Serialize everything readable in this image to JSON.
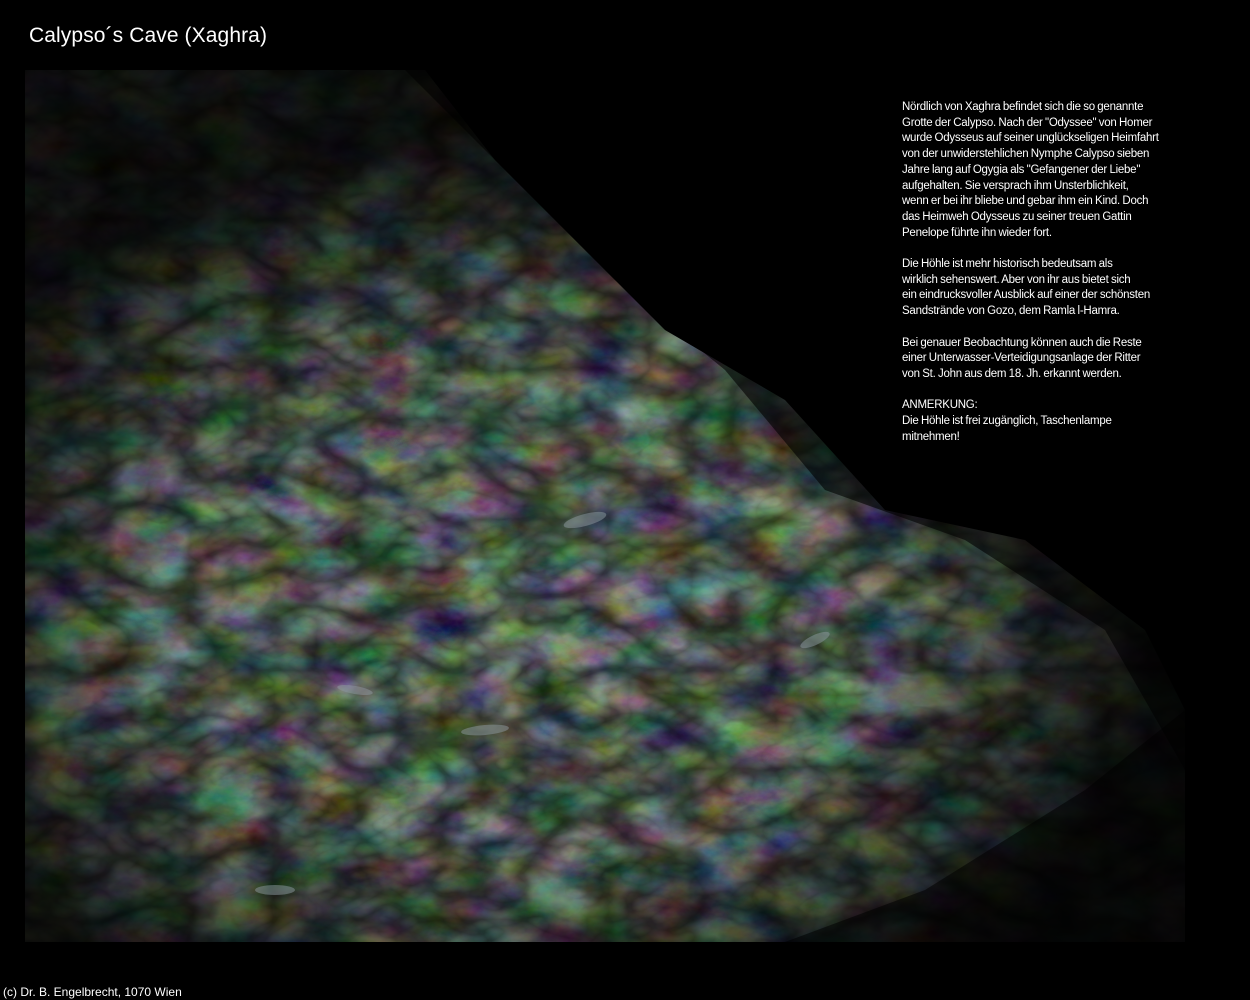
{
  "page": {
    "title": "Calypso´s Cave (Xaghra)",
    "copyright": "(c) Dr. B. Engelbrecht, 1070 Wien"
  },
  "photo": {
    "subject": "rock wall inside cave, dimly lit",
    "colors": {
      "rock_dark": "#1a1f1c",
      "rock_mid": "#3b403a",
      "rock_light": "#6f7266",
      "highlight": "#a9b3b8",
      "background": "#000000"
    }
  },
  "description": {
    "paragraphs": [
      "Nördlich von Xaghra befindet sich die so genannte\nGrotte der Calypso. Nach der \"Odyssee\" von Homer\nwurde Odysseus auf seiner unglückseligen Heimfahrt\nvon der unwiderstehlichen Nymphe Calypso sieben\nJahre lang auf Ogygia als \"Gefangener der Liebe\"\naufgehalten. Sie versprach ihm Unsterblichkeit,\nwenn er bei ihr bliebe und gebar ihm ein Kind. Doch\ndas Heimweh Odysseus zu seiner treuen Gattin\nPenelope führte ihn wieder fort.",
      "Die Höhle ist mehr historisch bedeutsam als\nwirklich sehenswert. Aber von ihr aus bietet sich\nein eindrucksvoller Ausblick auf einer der schönsten\nSandstrände von Gozo, dem Ramla l-Hamra.",
      "Bei genauer Beobachtung können auch die Reste\neiner Unterwasser-Verteidigungsanlage der Ritter\nvon St. John aus dem 18. Jh. erkannt werden.",
      "ANMERKUNG:\nDie Höhle ist frei zugänglich, Taschenlampe\nmitnehmen!"
    ]
  }
}
